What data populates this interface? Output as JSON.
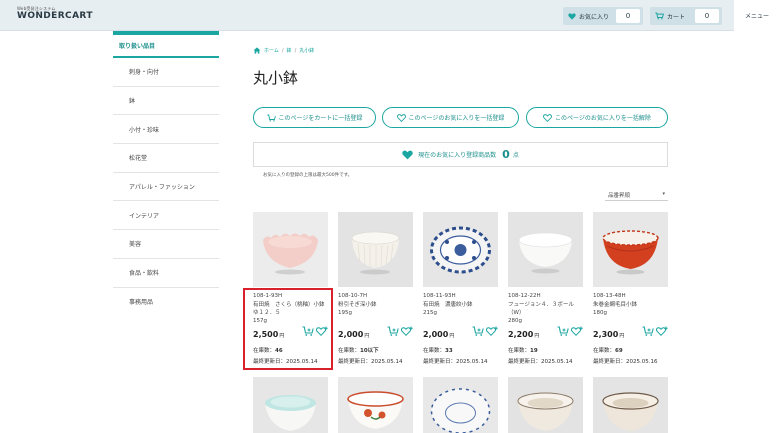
{
  "header": {
    "logo_tagline": "Web受発注システム",
    "logo_name": "WONDERCART",
    "favorites_label": "お気に入り",
    "favorites_count": "0",
    "cart_label": "カート",
    "cart_count": "0",
    "menu_label": "メニュー"
  },
  "sidebar": {
    "heading": "取り扱い品目",
    "items": [
      "刺身・向付",
      "鉢",
      "小付・珍味",
      "松花堂",
      "アパレル・ファッション",
      "インテリア",
      "美容",
      "食品・飲料",
      "事務用品"
    ]
  },
  "breadcrumb": {
    "home": "ホーム",
    "level1": "鉢",
    "level2": "丸小鉢"
  },
  "page_title": "丸小鉢",
  "actions": {
    "add_all_to_cart": "このページをカートに一括登録",
    "add_all_to_favorites": "このページのお気に入りを一括登録",
    "remove_all_favorites": "このページのお気に入りを一括解除"
  },
  "favorites_summary": {
    "label": "現在のお気に入り登録商品数",
    "count": "0",
    "unit": "点",
    "note": "お気に入りの登録の上限は最大500件です。"
  },
  "sort": {
    "selected": "品番昇順"
  },
  "price_unit": "円",
  "stock_label": "在庫数：",
  "updated_label": "最終更新日：",
  "products": [
    {
      "code": "108-1-93H",
      "name": "有田焼　さくら（桃釉）小鉢ゆ１２．５",
      "weight": "157g",
      "price": "2,500",
      "stock": "46",
      "updated": "2025.05.14",
      "color": "#f2c9c4"
    },
    {
      "code": "108-10-7H",
      "name": "粉引そぎ深小鉢",
      "weight": "195g",
      "price": "2,000",
      "stock": "10以下",
      "updated": "2025.05.14",
      "color": "#f3efe6"
    },
    {
      "code": "108-11-93H",
      "name": "有田焼　濃唐絞小鉢",
      "weight": "215g",
      "price": "2,000",
      "stock": "33",
      "updated": "2025.05.14",
      "color": "#2d4e8c"
    },
    {
      "code": "108-12-22H",
      "name": "フュージョン４．３ボール（W）",
      "weight": "280g",
      "price": "2,200",
      "stock": "19",
      "updated": "2025.05.14",
      "color": "#f7f7f5"
    },
    {
      "code": "108-13-48H",
      "name": "朱巻金網毛目小鉢",
      "weight": "180g",
      "price": "2,300",
      "stock": "69",
      "updated": "2025.05.16",
      "color": "#d23a1e"
    }
  ]
}
